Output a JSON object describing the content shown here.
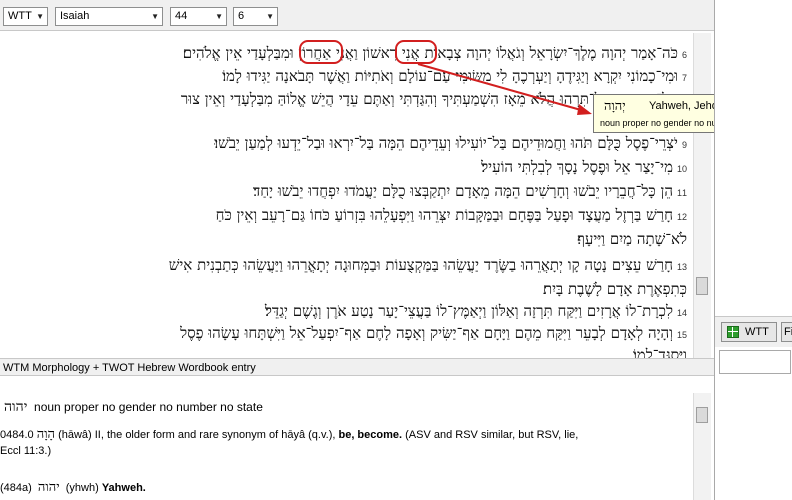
{
  "toolbar": {
    "version": "WTT",
    "book": "Isaiah",
    "chapter": "44",
    "verse": "6"
  },
  "verses": [
    {
      "num": "6",
      "lines": [
        "כֹּה־אָמַר יְהוָה מֶלֶךְ־יִשְׂרָאֵל וְגֹאֲלוֹ יְהוָה צְבָאוֹת אֲנִי רִאשׁוֹן וַאֲנִי אַחֲרוֹן וּמִבַּלְעָדַי אֵין אֱלֹהִים׃"
      ]
    },
    {
      "num": "7",
      "lines": [
        "וּמִי־כָמוֹנִי יִקְרָא וְיַגִּידֶהָ וְיַעְרְכֶהָ לִי מִשּׂוּמִי עַם־עוֹלָם וְאֹתִיּוֹת וַאֲשֶׁר תָּבֹאנָה יַגִּידוּ לָמוֹ׃"
      ]
    },
    {
      "num": "8",
      "lines": [
        "אַל־תִּפְחֲדוּ וְאַל־תִּרְהוּ הֲלֹא מֵאָז הִשְׁמַעְתִּיךָ וְהִגַּדְתִּי וְאַתֶּם עֵדָי הֲיֵשׁ אֱלוֹהַּ מִבַּלְעָדַי וְאֵין צוּר"
      ]
    },
    {
      "num": "9",
      "lines": [
        "יֹצְרֵי־פֶסֶל כֻּלָּם תֹּהוּ וַחֲמוּדֵיהֶם בַּל־יוֹעִילוּ וְעֵדֵיהֶם הֵמָּה בַּל־יִרְאוּ וּבַל־יֵדְעוּ לְמַעַן יֵבֹשׁוּ׃"
      ]
    },
    {
      "num": "10",
      "lines": [
        "מִי־יָצַר אֵל וּפֶסֶל נָסָךְ לְבִלְתִּי הוֹעִיל׃"
      ]
    },
    {
      "num": "11",
      "lines": [
        "הֵן כָּל־חֲבֵרָיו יֵבֹשׁוּ וְחָרָשִׁים הֵמָּה מֵאָדָם יִתְקַבְּצוּ כֻלָּם יַעֲמֹדוּ יִפְחֲדוּ יֵבֹשׁוּ יָחַד׃"
      ]
    },
    {
      "num": "12",
      "lines": [
        "חָרַשׁ בַּרְזֶל מַעֲצָד וּפָעַל בַּפֶּחָם וּבַמַּקָּבוֹת יִצְּרֵהוּ וַיִּפְעָלֵהוּ בִּזְרוֹעַ כֹּחוֹ גַּם־רָעֵב וְאֵין כֹּחַ",
        "לֹא־שָׁתָה מַיִם וַיִּיעָף׃"
      ]
    },
    {
      "num": "13",
      "lines": [
        "חָרַשׁ עֵצִים נָטָה קָו יְתָאֲרֵהוּ בַשֶּׂרֶד יַעֲשֵׂהוּ בַּמַּקְצֻעוֹת וּבַמְּחוּגָה יְתָאֳרֵהוּ וַיַּעֲשֵׂהוּ כְּתַבְנִית אִישׁ",
        "כְּתִפְאֶרֶת אָדָם לָשֶׁבֶת בָּיִת׃"
      ]
    },
    {
      "num": "14",
      "lines": [
        "לִכְרָת־לוֹ אֲרָזִים וַיִּקַּח תִּרְזָה וְאַלּוֹן וַיְאַמֶּץ־לוֹ בַּעֲצֵי־יָעַר נָטַע אֹרֶן וְגֶשֶׁם יְגַדֵּל׃"
      ]
    },
    {
      "num": "15",
      "lines": [
        "וְהָיָה לְאָדָם לְבָעֵר וַיִּקַּח מֵהֶם וַיָּחָם אַף־יַשִּׂיק וְאָפָה לָחֶם אַף־יִפְעַל־אֵל וַיִּשְׁתָּחוּ עָשָׂהוּ פֶסֶל",
        "וַיִּסְגָּד־לָמוֹ׃"
      ]
    }
  ],
  "tooltip": {
    "hebrew": "יְהוָה",
    "gloss": "Yahweh, Jehovah, LORD",
    "parse": "noun proper no gender no number no state"
  },
  "lexicon": {
    "title": "WTM Morphology + TWOT Hebrew Wordbook entry",
    "hebrew": "יהוה",
    "parse": "noun proper no gender no number no state",
    "entry_num": "0484.0",
    "entry_heb": "הָוָה",
    "entry_text": "(hāwâ) II, the older form and rare synonym of hāyâ (q.v.),",
    "entry_bold": "be, become.",
    "entry_note": "(ASV and RSV similar, but RSV, lie,",
    "entry_ref": "Eccl 11:3.)",
    "sub_num": "(484a)",
    "sub_heb": "יהוה",
    "sub_translit": "(yhwh)",
    "sub_bold": "Yahweh."
  },
  "right_panel": {
    "button1": "WTT",
    "button2": "Fi"
  },
  "colors": {
    "annotation": "#d21f1f",
    "tooltip_bg": "#ffffe1",
    "toolbar_bg": "#f0f0f0",
    "button_icon": "#2e9e2e"
  }
}
